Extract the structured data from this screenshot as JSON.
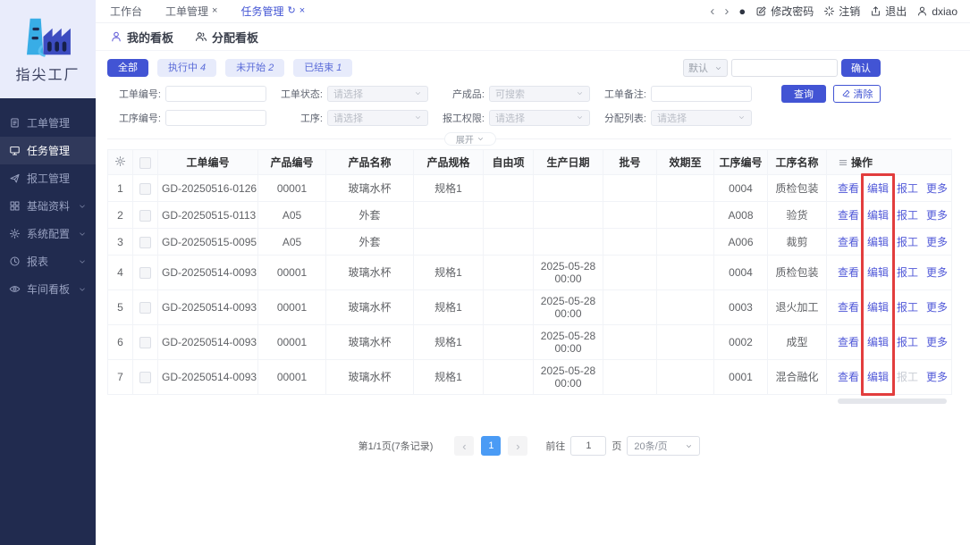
{
  "colors": {
    "primary": "#4254d4",
    "sidebar_bg": "#212b4f",
    "logo_panel_bg": "#e9ecfb",
    "link": "#5159d8",
    "highlight_red": "#e23d3d",
    "pagination_active": "#4a9bf5",
    "chip_bg": "#e7ebfb",
    "chip_text": "#5a6bd8"
  },
  "brand": {
    "name": "指尖工厂"
  },
  "window_tabs": [
    {
      "id": "workbench",
      "label": "工作台",
      "active": false,
      "closable": false,
      "refreshable": false
    },
    {
      "id": "work-orders",
      "label": "工单管理",
      "active": false,
      "closable": true,
      "refreshable": false
    },
    {
      "id": "tasks",
      "label": "任务管理",
      "active": true,
      "closable": true,
      "refreshable": true
    }
  ],
  "topbar": {
    "actions": [
      {
        "id": "change-password",
        "icon": "edit",
        "label": "修改密码"
      },
      {
        "id": "deregister",
        "icon": "asterisk",
        "label": "注销"
      },
      {
        "id": "exit",
        "icon": "logout",
        "label": "退出"
      },
      {
        "id": "user",
        "icon": "person",
        "label": "dxiao"
      }
    ]
  },
  "sidebar": {
    "items": [
      {
        "id": "work-order-mgmt",
        "icon": "document",
        "label": "工单管理",
        "active": false,
        "expandable": false
      },
      {
        "id": "task-mgmt",
        "icon": "monitor",
        "label": "任务管理",
        "active": true,
        "expandable": false
      },
      {
        "id": "report-mgmt",
        "icon": "send",
        "label": "报工管理",
        "active": false,
        "expandable": false
      },
      {
        "id": "base-data",
        "icon": "grid",
        "label": "基础资料",
        "active": false,
        "expandable": true
      },
      {
        "id": "system-config",
        "icon": "gear",
        "label": "系统配置",
        "active": false,
        "expandable": true
      },
      {
        "id": "reports",
        "icon": "clock",
        "label": "报表",
        "active": false,
        "expandable": true
      },
      {
        "id": "workshop-board",
        "icon": "eye",
        "label": "车间看板",
        "active": false,
        "expandable": true
      }
    ]
  },
  "board_tabs": [
    {
      "id": "my-board",
      "icon": "person",
      "label": "我的看板",
      "active": true
    },
    {
      "id": "assign-board",
      "icon": "people",
      "label": "分配看板",
      "active": false
    }
  ],
  "status_chips": [
    {
      "label": "全部",
      "count": "",
      "active": true
    },
    {
      "label": "执行中",
      "count": "4",
      "active": false
    },
    {
      "label": "未开始",
      "count": "2",
      "active": false
    },
    {
      "label": "已结束",
      "count": "1",
      "active": false
    }
  ],
  "preset": {
    "select_value": "默认",
    "input_value": "",
    "confirm_label": "确认"
  },
  "filters": {
    "rows": [
      [
        {
          "id": "order-no",
          "label": "工单编号:",
          "type": "input",
          "value": "",
          "placeholder": ""
        },
        {
          "id": "order-status",
          "label": "工单状态:",
          "type": "select",
          "placeholder": "请选择"
        },
        {
          "id": "product",
          "label": "产成品:",
          "type": "select",
          "placeholder": "可搜索"
        },
        {
          "id": "order-remark",
          "label": "工单备注:",
          "type": "input",
          "value": "",
          "placeholder": ""
        }
      ],
      [
        {
          "id": "process-no",
          "label": "工序编号:",
          "type": "input",
          "value": "",
          "placeholder": ""
        },
        {
          "id": "process",
          "label": "工序:",
          "type": "select",
          "placeholder": "请选择"
        },
        {
          "id": "report-permission",
          "label": "报工权限:",
          "type": "select",
          "placeholder": "请选择"
        },
        {
          "id": "assign-list",
          "label": "分配列表:",
          "type": "select",
          "placeholder": "请选择"
        }
      ]
    ],
    "search_label": "查询",
    "clear_label": "清除",
    "expand_label": "展开"
  },
  "table": {
    "headers": [
      "工单编号",
      "产品编号",
      "产品名称",
      "产品规格",
      "自由项",
      "生产日期",
      "批号",
      "效期至",
      "工序编号",
      "工序名称",
      "操作"
    ],
    "actions": [
      "查看",
      "编辑",
      "报工",
      "更多"
    ],
    "rows": [
      {
        "index": "1",
        "cells": [
          "GD-20250516-0126",
          "00001",
          "玻璃水杯",
          "规格1",
          "",
          "",
          "",
          "",
          "0004",
          "质检包装"
        ],
        "report_disabled": false
      },
      {
        "index": "2",
        "cells": [
          "GD-20250515-0113",
          "A05",
          "外套",
          "",
          "",
          "",
          "",
          "",
          "A008",
          "验货"
        ],
        "report_disabled": false
      },
      {
        "index": "3",
        "cells": [
          "GD-20250515-0095",
          "A05",
          "外套",
          "",
          "",
          "",
          "",
          "",
          "A006",
          "裁剪"
        ],
        "report_disabled": false
      },
      {
        "index": "4",
        "cells": [
          "GD-20250514-0093",
          "00001",
          "玻璃水杯",
          "规格1",
          "",
          "2025-05-28 00:00",
          "",
          "",
          "0004",
          "质检包装"
        ],
        "report_disabled": false
      },
      {
        "index": "5",
        "cells": [
          "GD-20250514-0093",
          "00001",
          "玻璃水杯",
          "规格1",
          "",
          "2025-05-28 00:00",
          "",
          "",
          "0003",
          "退火加工"
        ],
        "report_disabled": false
      },
      {
        "index": "6",
        "cells": [
          "GD-20250514-0093",
          "00001",
          "玻璃水杯",
          "规格1",
          "",
          "2025-05-28 00:00",
          "",
          "",
          "0002",
          "成型"
        ],
        "report_disabled": false
      },
      {
        "index": "7",
        "cells": [
          "GD-20250514-0093",
          "00001",
          "玻璃水杯",
          "规格1",
          "",
          "2025-05-28 00:00",
          "",
          "",
          "0001",
          "混合融化"
        ],
        "report_disabled": true
      }
    ]
  },
  "pagination": {
    "summary": "第1/1页(7条记录)",
    "current_page": "1",
    "goto_label": "前往",
    "goto_value": "1",
    "page_unit": "页",
    "page_size": "20条/页"
  }
}
